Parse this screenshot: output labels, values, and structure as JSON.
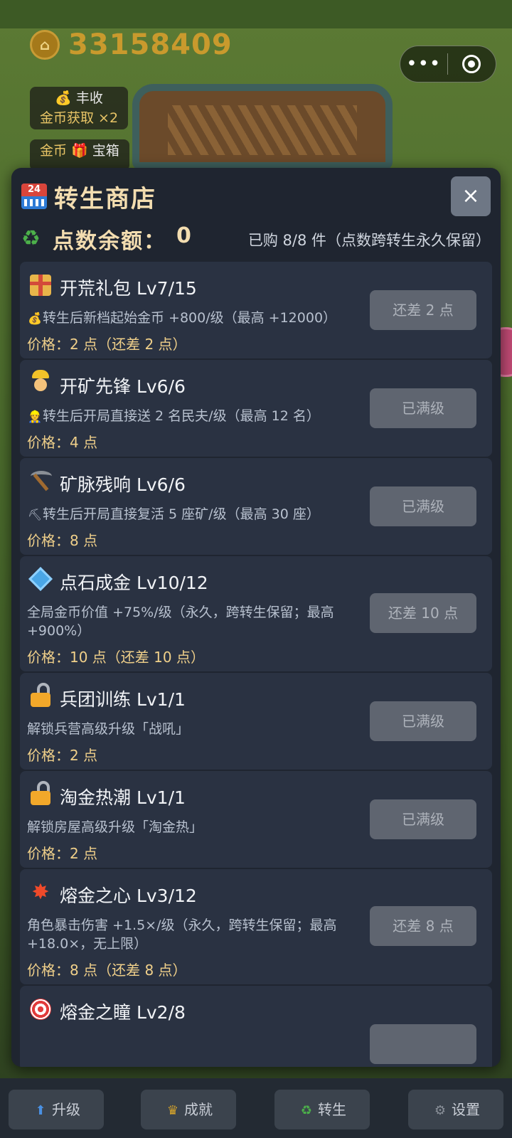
{
  "hud": {
    "coins": "33158409",
    "badges": [
      {
        "icon": "money-bag-icon",
        "title": "丰收",
        "value": "金币获取 ×2"
      },
      {
        "icon": "gift-icon",
        "title": "宝箱",
        "value": "金币"
      }
    ]
  },
  "modal": {
    "title": "转生商店",
    "close_label": "×",
    "points_label": "点数余额：",
    "points_value": "0",
    "purchased_text": "已购 8/8 件（点数跨转生永久保留）",
    "items": [
      {
        "icon": "gift-icon",
        "title": "开荒礼包 Lv7/15",
        "desc": "转生后新档起始金币 +800/级（最高 +12000）",
        "desc_icon": "money-bag-icon",
        "price": "价格：2 点（还差 2 点）",
        "button": "还差 2 点"
      },
      {
        "icon": "construction-worker-icon",
        "title": "开矿先锋 Lv6/6",
        "desc": "转生后开局直接送 2 名民夫/级（最高 12 名）",
        "desc_icon": "construction-worker-icon",
        "price": "价格：4 点",
        "button": "已满级"
      },
      {
        "icon": "pickaxe-icon",
        "title": "矿脉残响 Lv6/6",
        "desc": "转生后开局直接复活 5 座矿/级（最高 30 座）",
        "desc_icon": "pickaxe-icon",
        "price": "价格：8 点",
        "button": "已满级"
      },
      {
        "icon": "diamond-icon",
        "title": "点石成金 Lv10/12",
        "desc": "全局金币价值 +75%/级（永久，跨转生保留；最高 +900%）",
        "price": "价格：10 点（还差 10 点）",
        "button": "还差 10 点"
      },
      {
        "icon": "unlock-icon",
        "title": "兵团训练 Lv1/1",
        "desc": "解锁兵营高级升级「战吼」",
        "price": "价格：2 点",
        "button": "已满级"
      },
      {
        "icon": "unlock-icon",
        "title": "淘金热潮 Lv1/1",
        "desc": "解锁房屋高级升级「淘金热」",
        "price": "价格：2 点",
        "button": "已满级"
      },
      {
        "icon": "collision-icon",
        "title": "熔金之心 Lv3/12",
        "desc": "角色暴击伤害 +1.5×/级（永久，跨转生保留；最高 +18.0×，无上限）",
        "price": "价格：8 点（还差 8 点）",
        "button": "还差 8 点"
      },
      {
        "icon": "target-icon",
        "title": "熔金之瞳 Lv2/8"
      }
    ]
  },
  "bottom_nav": [
    {
      "icon": "up-arrow-icon",
      "label": "升级"
    },
    {
      "icon": "trophy-icon",
      "label": "成就"
    },
    {
      "icon": "recycle-icon",
      "label": "转生"
    },
    {
      "icon": "gear-icon",
      "label": "设置"
    }
  ]
}
